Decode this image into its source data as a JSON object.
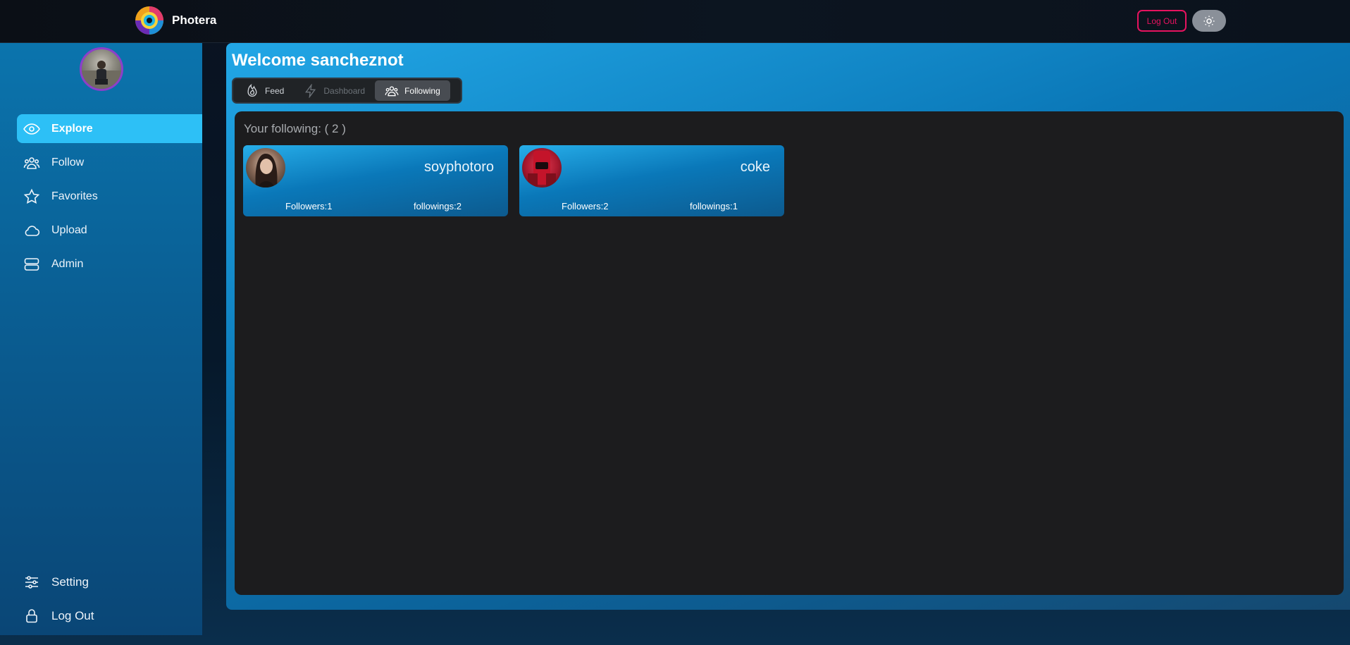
{
  "app": {
    "name": "Photera"
  },
  "header": {
    "logout_label": "Log Out",
    "theme_icon": "sun-icon"
  },
  "sidebar": {
    "items": [
      {
        "label": "Explore",
        "icon": "eye-icon",
        "active": true
      },
      {
        "label": "Follow",
        "icon": "users-icon"
      },
      {
        "label": "Favorites",
        "icon": "star-icon"
      },
      {
        "label": "Upload",
        "icon": "cloud-icon"
      },
      {
        "label": "Admin",
        "icon": "server-icon"
      }
    ],
    "bottom": [
      {
        "label": "Setting",
        "icon": "sliders-icon"
      },
      {
        "label": "Log Out",
        "icon": "lock-icon"
      }
    ]
  },
  "main": {
    "welcome": "Welcome sancheznot",
    "tabs": [
      {
        "label": "Feed",
        "icon": "fire-icon"
      },
      {
        "label": "Dashboard",
        "icon": "bolt-icon",
        "disabled": true
      },
      {
        "label": "Following",
        "icon": "users-icon",
        "selected": true
      }
    ],
    "following_title": "Your following: ( 2 )",
    "following": [
      {
        "username": "soyphotoro",
        "followers": "Followers:1",
        "followings": "followings:2"
      },
      {
        "username": "coke",
        "followers": "Followers:2",
        "followings": "followings:1"
      }
    ]
  },
  "colors": {
    "accent": "#2dc0f6",
    "logout": "#e6135f",
    "panel": "#1c1c1e"
  }
}
